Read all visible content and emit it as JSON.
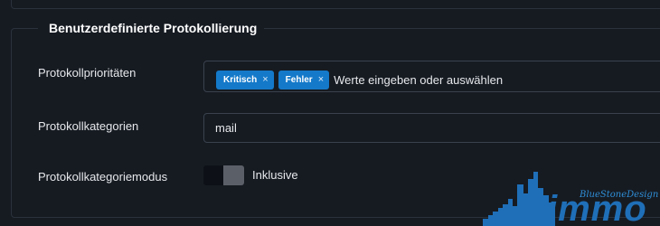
{
  "section": {
    "title": "Benutzerdefinierte Protokollierung"
  },
  "priorities": {
    "label": "Protokollprioritäten",
    "tags": [
      {
        "label": "Kritisch",
        "remove": "×"
      },
      {
        "label": "Fehler",
        "remove": "×"
      }
    ],
    "placeholder": "Werte eingeben oder auswählen"
  },
  "categories": {
    "label": "Protokollkategorien",
    "value": "mail"
  },
  "mode": {
    "label": "Protokollkategoriemodus",
    "toggle_label": "Inklusive"
  },
  "watermark": {
    "script_text": "BlueStoneDesign",
    "word": "immo",
    "color": "#1f6fb8"
  },
  "colors": {
    "background": "#161b22",
    "border": "#2b323b",
    "tag": "#1479c9"
  }
}
